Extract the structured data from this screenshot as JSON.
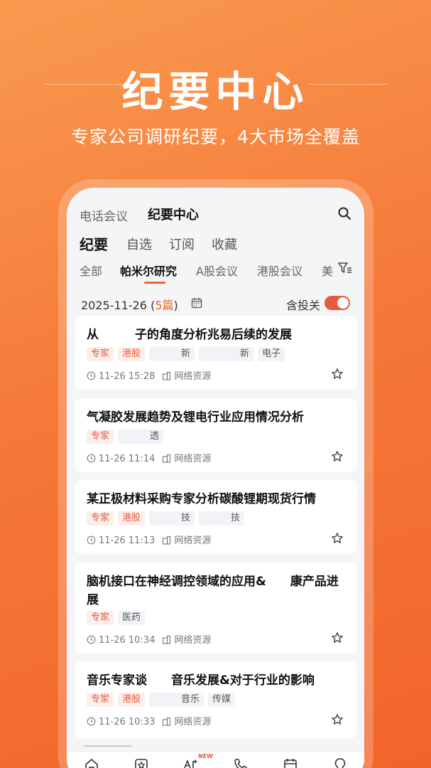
{
  "hero": {
    "title": "纪要中心",
    "subtitle": "专家公司调研纪要，4大市场全覆盖"
  },
  "topnav": {
    "tab1": "电话会议",
    "tab2": "纪要中心",
    "search_icon": "search-icon"
  },
  "subtabs": [
    "纪要",
    "自选",
    "订阅",
    "收藏"
  ],
  "categories": [
    "全部",
    "帕米尔研究",
    "A股会议",
    "港股会议",
    "美"
  ],
  "date_row": {
    "date": "2025-11-26",
    "count_open": " (",
    "count": "5篇",
    "count_close": ")",
    "toggle_label": "含投关",
    "toggle_on": true
  },
  "cards": [
    {
      "title": "从　　　子的角度分析兆易后续的发展",
      "tags": [
        {
          "text": "专家",
          "style": "red"
        },
        {
          "text": "港股",
          "style": "red"
        },
        {
          "text": "　　　新",
          "style": "gray"
        },
        {
          "text": "　　　　新",
          "style": "gray"
        },
        {
          "text": "电子",
          "style": "gray"
        }
      ],
      "time": "11-26 15:28",
      "source": "网络资源"
    },
    {
      "title": "气凝胶发展趋势及锂电行业应用情况分析",
      "tags": [
        {
          "text": "专家",
          "style": "red"
        },
        {
          "text": "　　　透",
          "style": "gray"
        }
      ],
      "time": "11-26 11:14",
      "source": "网络资源"
    },
    {
      "title": "某正极材料采购专家分析碳酸锂期现货行情",
      "tags": [
        {
          "text": "专家",
          "style": "red"
        },
        {
          "text": "港股",
          "style": "red"
        },
        {
          "text": "　　　技",
          "style": "gray"
        },
        {
          "text": "　　　技",
          "style": "gray"
        }
      ],
      "time": "11-26 11:13",
      "source": "网络资源"
    },
    {
      "title": "脑机接口在神经调控领域的应用&　　康产品进展",
      "tags": [
        {
          "text": "专家",
          "style": "red"
        },
        {
          "text": "医药",
          "style": "gray"
        }
      ],
      "time": "11-26 10:34",
      "source": "网络资源"
    },
    {
      "title": "音乐专家谈　　音乐发展&对于行业的影响",
      "tags": [
        {
          "text": "专家",
          "style": "red"
        },
        {
          "text": "港股",
          "style": "red"
        },
        {
          "text": "　　　音乐",
          "style": "gray"
        },
        {
          "text": "传媒",
          "style": "gray"
        }
      ],
      "time": "11-26 10:33",
      "source": "网络资源"
    }
  ],
  "tabbar": {
    "icons": [
      "home-icon",
      "star-box-icon",
      "ai-icon",
      "phone-icon",
      "calendar-icon",
      "lightbulb-icon"
    ],
    "new_badge": "NEW"
  },
  "colors": {
    "accent": "#f2642a",
    "tag_red_bg": "#fdeee9",
    "tag_red_fg": "#e85a3c",
    "toggle_on": "#e85a3c"
  }
}
